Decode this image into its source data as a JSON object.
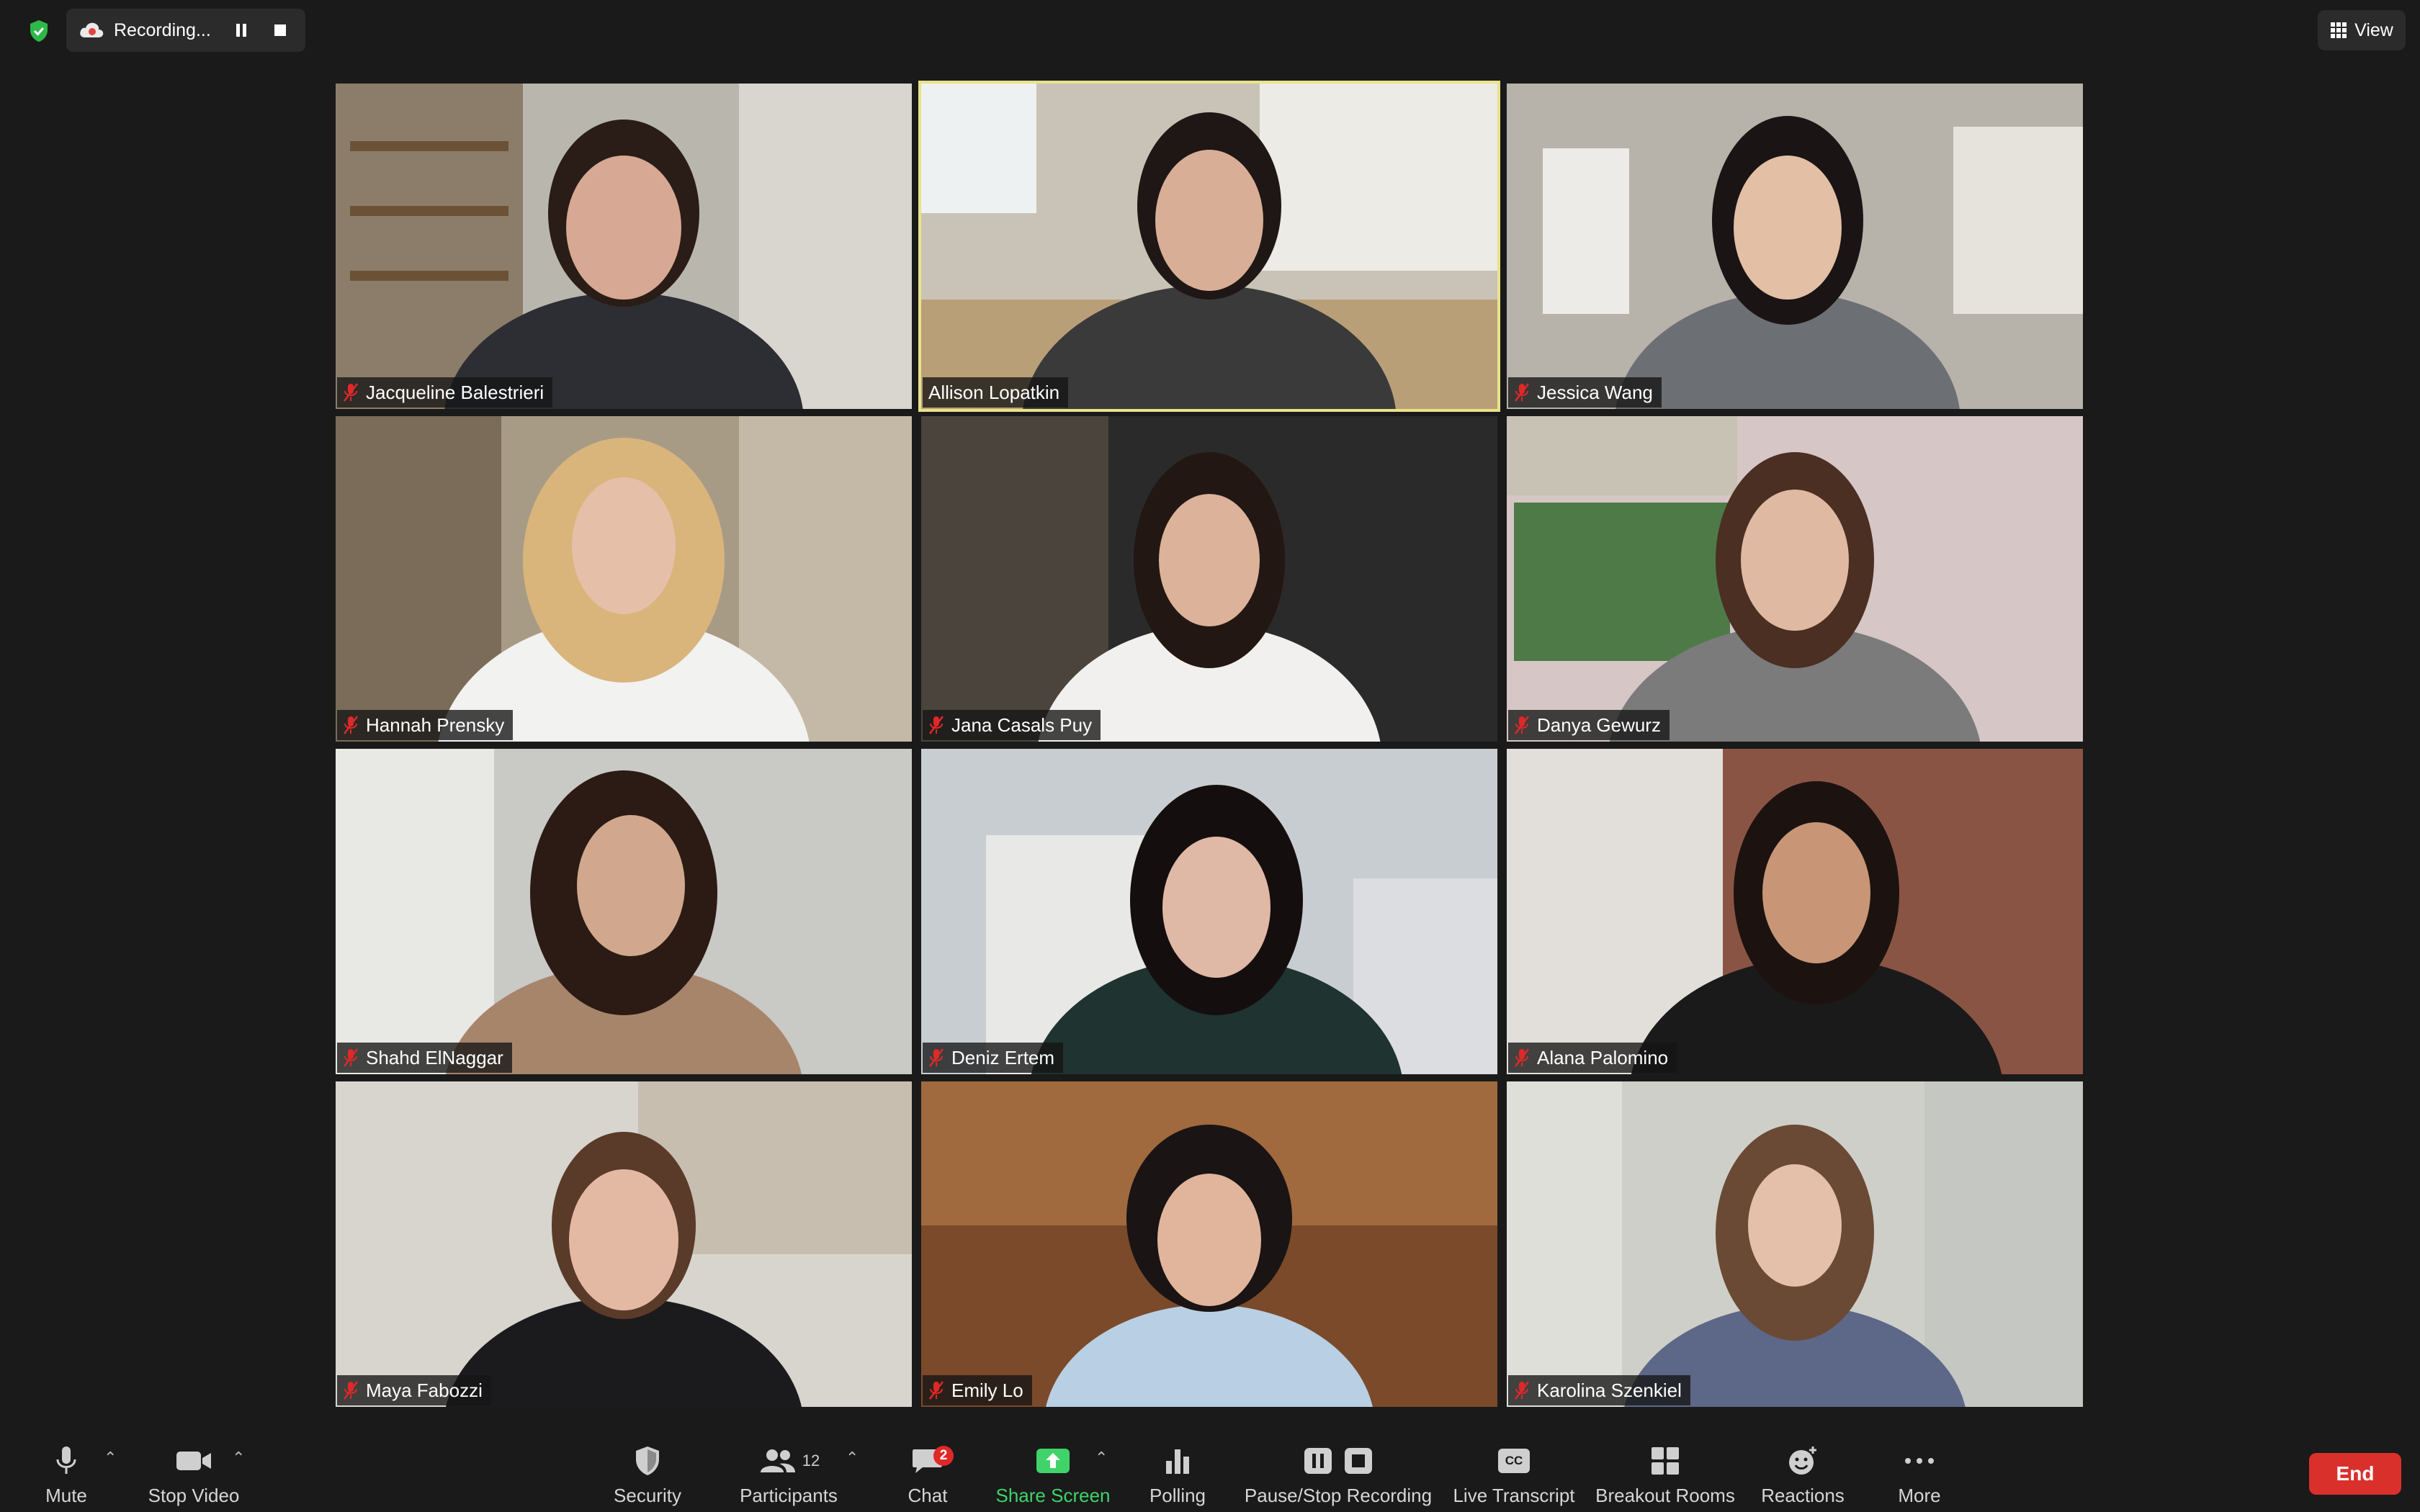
{
  "top_bar": {
    "recording_label": "Recording...",
    "view_label": "View"
  },
  "participants": [
    {
      "name": "Jacqueline Balestrieri",
      "muted": true,
      "active": false
    },
    {
      "name": "Allison Lopatkin",
      "muted": false,
      "active": true
    },
    {
      "name": "Jessica Wang",
      "muted": true,
      "active": false
    },
    {
      "name": "Hannah Prensky",
      "muted": true,
      "active": false
    },
    {
      "name": "Jana Casals Puy",
      "muted": true,
      "active": false
    },
    {
      "name": "Danya Gewurz",
      "muted": true,
      "active": false
    },
    {
      "name": "Shahd ElNaggar",
      "muted": true,
      "active": false
    },
    {
      "name": "Deniz Ertem",
      "muted": true,
      "active": false
    },
    {
      "name": "Alana Palomino",
      "muted": true,
      "active": false
    },
    {
      "name": "Maya Fabozzi",
      "muted": true,
      "active": false
    },
    {
      "name": "Emily Lo",
      "muted": true,
      "active": false
    },
    {
      "name": "Karolina Szenkiel",
      "muted": true,
      "active": false
    }
  ],
  "toolbar": {
    "mute_label": "Mute",
    "stop_video_label": "Stop Video",
    "security_label": "Security",
    "participants_label": "Participants",
    "participants_count": "12",
    "chat_label": "Chat",
    "chat_badge": "2",
    "share_screen_label": "Share Screen",
    "polling_label": "Polling",
    "pause_stop_recording_label": "Pause/Stop Recording",
    "live_transcript_label": "Live Transcript",
    "cc_icon_text": "CC",
    "breakout_rooms_label": "Breakout Rooms",
    "reactions_label": "Reactions",
    "more_label": "More",
    "end_label": "End"
  },
  "colors": {
    "background": "#1a1a1a",
    "active_speaker_border": "#e8e38a",
    "share_green": "#3fd36a",
    "end_red": "#d9302c",
    "muted_red": "#e02828"
  }
}
